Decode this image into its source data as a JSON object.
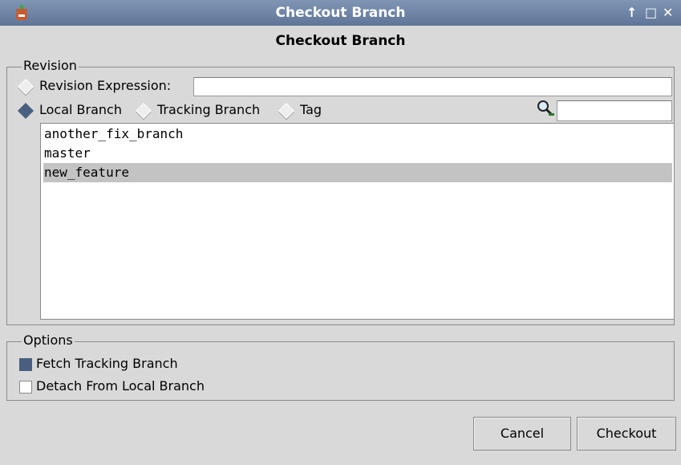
{
  "window": {
    "title": "Checkout Branch",
    "controls": [
      "↑",
      "□",
      "✕"
    ]
  },
  "heading": "Checkout Branch",
  "revision": {
    "legend": "Revision",
    "expression_label": "Revision Expression:",
    "expression_value": "",
    "source_options": [
      {
        "label": "Local Branch",
        "selected": true
      },
      {
        "label": "Tracking Branch",
        "selected": false
      },
      {
        "label": "Tag",
        "selected": false
      }
    ],
    "filter_value": "",
    "branches": [
      "another_fix_branch",
      "master",
      "new_feature"
    ],
    "selected_branch": "new_feature"
  },
  "options": {
    "legend": "Options",
    "fetch_tracking": {
      "label": "Fetch Tracking Branch",
      "checked": true
    },
    "detach_local": {
      "label": "Detach From Local Branch",
      "checked": false
    }
  },
  "buttons": {
    "cancel": "Cancel",
    "checkout": "Checkout"
  },
  "colors": {
    "titlebar": "#6a81a4",
    "selection": "#c3c3c3",
    "indicator": "#485f80",
    "background": "#d9d9d9"
  }
}
